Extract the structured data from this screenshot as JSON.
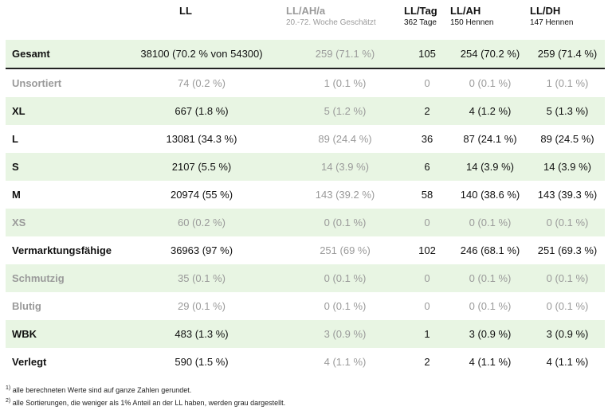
{
  "header": {
    "ll": "LL",
    "llah_a": "LL/AH/a",
    "llah_a_sub": "20.-72. Woche Geschätzt",
    "lltag": "LL/Tag",
    "lltag_sub": "362 Tage",
    "llah": "LL/AH",
    "llah_sub": "150 Hennen",
    "lldh": "LL/DH",
    "lldh_sub": "147 Hennen"
  },
  "rows": [
    {
      "label": "Gesamt",
      "ll": "38100 (70.2 % von 54300)",
      "llah_a": "259 (71.1 %)",
      "lltag": "105",
      "llah": "254 (70.2 %)",
      "lldh": "259 (71.4 %)"
    },
    {
      "label": "Unsortiert",
      "ll": "74 (0.2 %)",
      "llah_a": "1 (0.1 %)",
      "lltag": "0",
      "llah": "0 (0.1 %)",
      "lldh": "1 (0.1 %)"
    },
    {
      "label": "XL",
      "ll": "667 (1.8 %)",
      "llah_a": "5 (1.2 %)",
      "lltag": "2",
      "llah": "4 (1.2 %)",
      "lldh": "5 (1.3 %)"
    },
    {
      "label": "L",
      "ll": "13081 (34.3 %)",
      "llah_a": "89 (24.4 %)",
      "lltag": "36",
      "llah": "87 (24.1 %)",
      "lldh": "89 (24.5 %)"
    },
    {
      "label": "S",
      "ll": "2107 (5.5 %)",
      "llah_a": "14 (3.9 %)",
      "lltag": "6",
      "llah": "14 (3.9 %)",
      "lldh": "14 (3.9 %)"
    },
    {
      "label": "M",
      "ll": "20974 (55 %)",
      "llah_a": "143 (39.2 %)",
      "lltag": "58",
      "llah": "140 (38.6 %)",
      "lldh": "143 (39.3 %)"
    },
    {
      "label": "XS",
      "ll": "60 (0.2 %)",
      "llah_a": "0 (0.1 %)",
      "lltag": "0",
      "llah": "0 (0.1 %)",
      "lldh": "0 (0.1 %)"
    },
    {
      "label": "Vermarktungsfähige",
      "ll": "36963 (97 %)",
      "llah_a": "251 (69 %)",
      "lltag": "102",
      "llah": "246 (68.1 %)",
      "lldh": "251 (69.3 %)"
    },
    {
      "label": "Schmutzig",
      "ll": "35 (0.1 %)",
      "llah_a": "0 (0.1 %)",
      "lltag": "0",
      "llah": "0 (0.1 %)",
      "lldh": "0 (0.1 %)"
    },
    {
      "label": "Blutig",
      "ll": "29 (0.1 %)",
      "llah_a": "0 (0.1 %)",
      "lltag": "0",
      "llah": "0 (0.1 %)",
      "lldh": "0 (0.1 %)"
    },
    {
      "label": "WBK",
      "ll": "483 (1.3 %)",
      "llah_a": "3 (0.9 %)",
      "lltag": "1",
      "llah": "3 (0.9 %)",
      "lldh": "3 (0.9 %)"
    },
    {
      "label": "Verlegt",
      "ll": "590 (1.5 %)",
      "llah_a": "4 (1.1 %)",
      "lltag": "2",
      "llah": "4 (1.1 %)",
      "lldh": "4 (1.1 %)"
    }
  ],
  "footnotes": [
    {
      "mark": "1)",
      "text": " alle berechneten Werte sind auf ganze Zahlen gerundet."
    },
    {
      "mark": "2)",
      "text": " alle Sortierungen, die weniger als 1% Anteil an der LL haben, werden grau dargestellt."
    }
  ],
  "colors": {
    "row_shade": "#e8f5e3",
    "muted_text": "#9a9a9a"
  }
}
